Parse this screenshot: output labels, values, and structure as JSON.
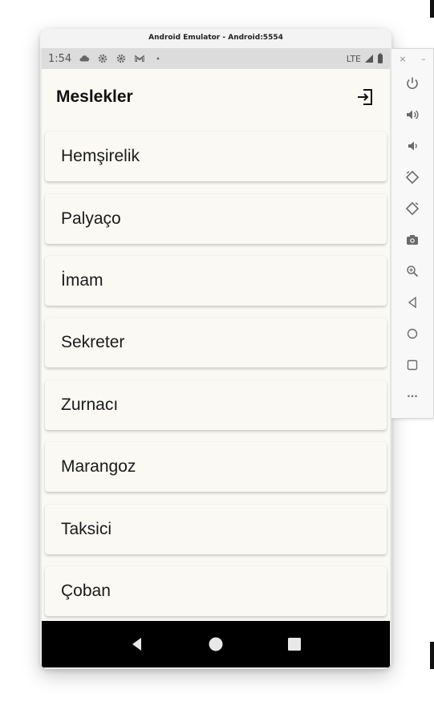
{
  "emulator": {
    "window_title": "Android Emulator - Android:5554"
  },
  "status_bar": {
    "time": "1:54",
    "network": "LTE"
  },
  "app_bar": {
    "title": "Meslekler"
  },
  "professions": [
    "Hemşirelik",
    "Palyaço",
    "İmam",
    "Sekreter",
    "Zurnacı",
    "Marangoz",
    "Taksici",
    "Çoban"
  ],
  "toolbar": {
    "close_label": "×",
    "minimize_label": "–",
    "more_label": "···"
  },
  "colors": {
    "app_background": "#faf9f4",
    "status_bar": "#dcdcdc",
    "nav_bar": "#000000",
    "toolbar_icon": "#6a6a6a"
  }
}
